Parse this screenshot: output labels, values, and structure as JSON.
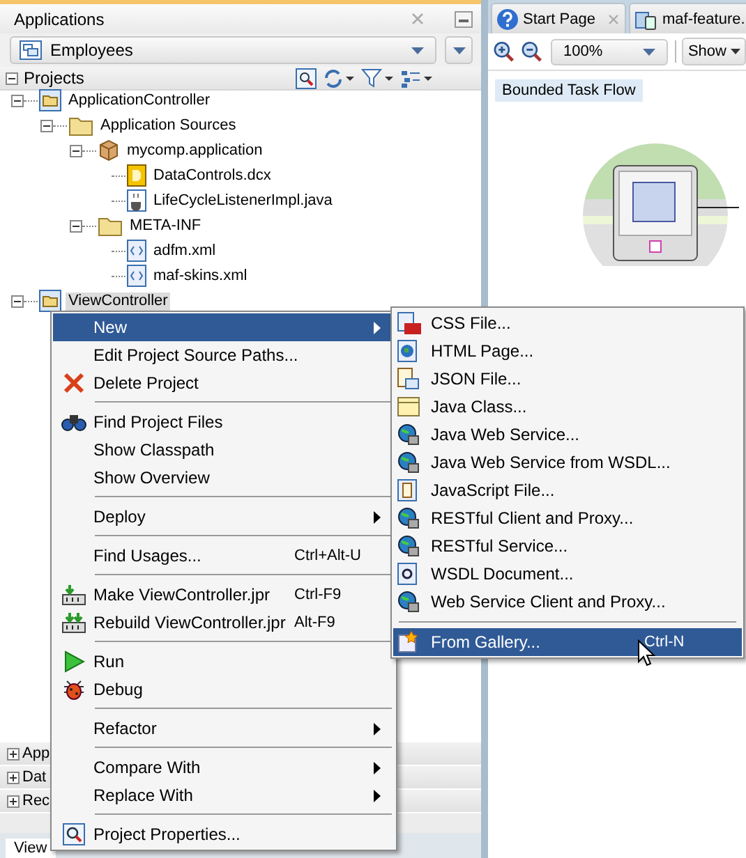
{
  "panel": {
    "title": "Applications",
    "app_selector": "Employees",
    "projects_header": "Projects",
    "tree": [
      {
        "label": "ApplicationController",
        "kind": "project",
        "expanded": true,
        "selected": false,
        "children": [
          {
            "label": "Application Sources",
            "kind": "folder",
            "expanded": true,
            "selected": false,
            "children": [
              {
                "label": "mycomp.application",
                "kind": "package",
                "expanded": true,
                "selected": false,
                "children": [
                  {
                    "label": "DataControls.dcx",
                    "kind": "dcx",
                    "selected": false
                  },
                  {
                    "label": "LifeCycleListenerImpl.java",
                    "kind": "java",
                    "selected": false
                  }
                ]
              },
              {
                "label": "META-INF",
                "kind": "folder",
                "expanded": true,
                "selected": false,
                "children": [
                  {
                    "label": "adfm.xml",
                    "kind": "xml",
                    "selected": false
                  },
                  {
                    "label": "maf-skins.xml",
                    "kind": "xml",
                    "selected": false
                  }
                ]
              }
            ]
          }
        ]
      },
      {
        "label": "ViewController",
        "kind": "project",
        "expanded": true,
        "selected": true
      }
    ],
    "collapsed_panels": [
      {
        "label": "App"
      },
      {
        "label": "Dat"
      },
      {
        "label": "Rec"
      }
    ],
    "bottom_tabs": [
      {
        "label": "View",
        "selected": true
      }
    ]
  },
  "editor": {
    "tabs": [
      {
        "label": "Start Page",
        "kind": "help"
      },
      {
        "label": "maf-feature.",
        "kind": "feature"
      }
    ],
    "zoom": "100%",
    "show_button": "Show",
    "canvas_label": "Bounded Task Flow"
  },
  "context_menu": [
    {
      "kind": "item",
      "label": "New",
      "submenu": true,
      "selected": true
    },
    {
      "kind": "item",
      "label": "Edit Project Source Paths...",
      "selected": false
    },
    {
      "kind": "item",
      "label": "Delete Project",
      "selected": false
    },
    {
      "kind": "separator"
    },
    {
      "kind": "item",
      "label": "Find Project Files",
      "selected": false
    },
    {
      "kind": "item",
      "label": "Show Classpath",
      "selected": false
    },
    {
      "kind": "item",
      "label": "Show Overview",
      "selected": false
    },
    {
      "kind": "separator"
    },
    {
      "kind": "item",
      "label": "Deploy",
      "submenu": true,
      "selected": false
    },
    {
      "kind": "separator"
    },
    {
      "kind": "item",
      "label": "Find Usages...",
      "shortcut": "Ctrl+Alt-U",
      "selected": false
    },
    {
      "kind": "separator"
    },
    {
      "kind": "item",
      "label": "Make ViewController.jpr",
      "shortcut": "Ctrl-F9",
      "selected": false
    },
    {
      "kind": "item",
      "label": "Rebuild ViewController.jpr",
      "shortcut": "Alt-F9",
      "selected": false
    },
    {
      "kind": "separator"
    },
    {
      "kind": "item",
      "label": "Run",
      "selected": false
    },
    {
      "kind": "item",
      "label": "Debug",
      "selected": false
    },
    {
      "kind": "separator"
    },
    {
      "kind": "item",
      "label": "Refactor",
      "submenu": true,
      "selected": false
    },
    {
      "kind": "separator"
    },
    {
      "kind": "item",
      "label": "Compare With",
      "submenu": true,
      "selected": false
    },
    {
      "kind": "item",
      "label": "Replace With",
      "submenu": true,
      "selected": false
    },
    {
      "kind": "separator"
    },
    {
      "kind": "item",
      "label": "Project Properties...",
      "selected": false
    }
  ],
  "new_submenu": [
    {
      "kind": "item",
      "label": "CSS File...",
      "selected": false
    },
    {
      "kind": "item",
      "label": "HTML Page...",
      "selected": false
    },
    {
      "kind": "item",
      "label": "JSON File...",
      "selected": false
    },
    {
      "kind": "item",
      "label": "Java Class...",
      "selected": false
    },
    {
      "kind": "item",
      "label": "Java Web Service...",
      "selected": false
    },
    {
      "kind": "item",
      "label": "Java Web Service from WSDL...",
      "selected": false
    },
    {
      "kind": "item",
      "label": "JavaScript File...",
      "selected": false
    },
    {
      "kind": "item",
      "label": "RESTful Client and Proxy...",
      "selected": false
    },
    {
      "kind": "item",
      "label": "RESTful Service...",
      "selected": false
    },
    {
      "kind": "item",
      "label": "WSDL Document...",
      "selected": false
    },
    {
      "kind": "item",
      "label": "Web Service Client and Proxy...",
      "selected": false
    },
    {
      "kind": "separator"
    },
    {
      "kind": "item",
      "label": "From Gallery...",
      "shortcut": "Ctrl-N",
      "selected": true
    }
  ]
}
